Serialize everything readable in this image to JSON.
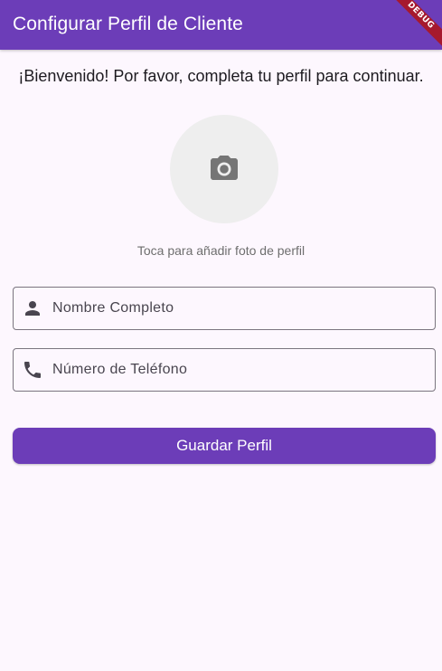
{
  "app_bar": {
    "title": "Configurar Perfil de Cliente",
    "debug_banner": "DEBUG",
    "color": "#6c3db8"
  },
  "welcome_text": "¡Bienvenido! Por favor, completa tu perfil para continuar.",
  "avatar": {
    "icon": "camera-icon",
    "hint": "Toca para añadir foto de perfil"
  },
  "fields": {
    "name": {
      "icon": "person-icon",
      "label": "Nombre Completo",
      "value": ""
    },
    "phone": {
      "icon": "phone-icon",
      "label": "Número de Teléfono",
      "value": ""
    }
  },
  "save_button": {
    "label": "Guardar Perfil",
    "color": "#6c3db8"
  }
}
